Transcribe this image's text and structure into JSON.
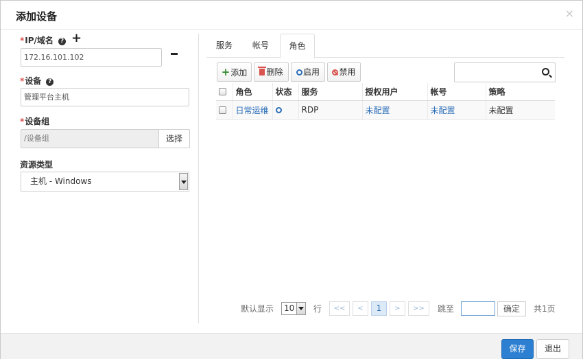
{
  "dialog": {
    "title": "添加设备",
    "close_glyph": "×"
  },
  "form": {
    "required_mark": "*",
    "ip": {
      "label": "IP/域名",
      "value": "172.16.101.102"
    },
    "device": {
      "label": "设备",
      "value": "管理平台主机"
    },
    "group": {
      "label": "设备组",
      "placeholder": "/设备组",
      "select_label": "选择"
    },
    "resource_type": {
      "label": "资源类型",
      "value": "主机 - Windows"
    }
  },
  "tabs": [
    "服务",
    "帐号",
    "角色"
  ],
  "active_tab": "角色",
  "toolbar": {
    "add": "添加",
    "delete": "删除",
    "enable": "启用",
    "disable": "禁用"
  },
  "search": {
    "placeholder": ""
  },
  "table": {
    "headers": [
      "角色",
      "状态",
      "服务",
      "授权用户",
      "帐号",
      "策略"
    ],
    "rows": [
      {
        "role": "日常运维",
        "status": "enabled",
        "service": "RDP",
        "auth_user": "未配置",
        "account": "未配置",
        "policy": "未配置"
      }
    ]
  },
  "pagination": {
    "default_show_label": "默认显示",
    "page_size": "10",
    "rows_label": "行",
    "first": "<<",
    "prev": "<",
    "current": "1",
    "next": ">",
    "last": ">>",
    "goto_label": "跳至",
    "goto_value": "",
    "confirm": "确定",
    "total": "共1页"
  },
  "footer": {
    "save": "保存",
    "exit": "退出"
  },
  "colors": {
    "primary": "#2d7fd1",
    "link": "#2a6db8",
    "danger": "#d9534f",
    "success": "#2e8b2e"
  }
}
